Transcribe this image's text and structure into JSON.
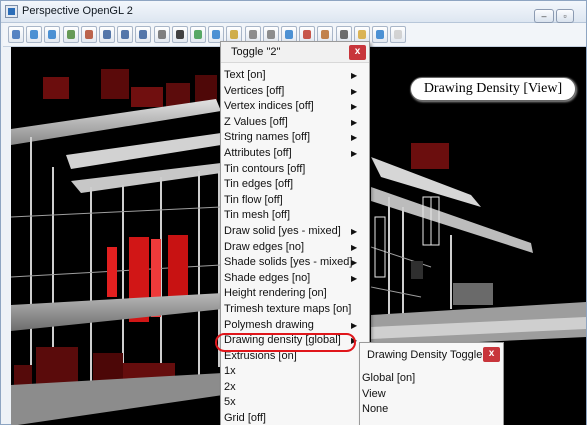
{
  "window": {
    "title": "Perspective OpenGL 2",
    "min_label": "–",
    "max_label": "▫",
    "close_label": "x"
  },
  "toolbar": {
    "buttons": [
      {
        "name": "new-view-icon",
        "color": "#3a6fb8"
      },
      {
        "name": "zoom-in-icon",
        "color": "#2f7fcc"
      },
      {
        "name": "zoom-out-icon",
        "color": "#2f7fcc"
      },
      {
        "name": "pan-icon",
        "color": "#4d8a3a"
      },
      {
        "name": "rotate-icon",
        "color": "#b24a2e"
      },
      {
        "name": "zoom-extents-icon",
        "color": "#375f9b"
      },
      {
        "name": "zoom-window-icon",
        "color": "#375f9b"
      },
      {
        "name": "zoom-previous-icon",
        "color": "#375f9b"
      },
      {
        "name": "walk-icon",
        "color": "#6a6a6a"
      },
      {
        "name": "eye-icon",
        "color": "#222222"
      },
      {
        "name": "render-icon",
        "color": "#3c9a4b"
      },
      {
        "name": "fly-icon",
        "color": "#2f7fcc"
      },
      {
        "name": "lights-icon",
        "color": "#c9a12b"
      },
      {
        "name": "camera-icon",
        "color": "#7a7a7a"
      },
      {
        "name": "settings-icon",
        "color": "#7a7a7a"
      },
      {
        "name": "texture-icon",
        "color": "#2f7fcc"
      },
      {
        "name": "section-icon",
        "color": "#c0392b"
      },
      {
        "name": "clip-icon",
        "color": "#b86d2e"
      },
      {
        "name": "measure-icon",
        "color": "#555555"
      },
      {
        "name": "folder-icon",
        "color": "#d6a83a"
      },
      {
        "name": "star-icon",
        "color": "#2f7fcc"
      },
      {
        "name": "blank-icon",
        "color": "#cccccc"
      }
    ]
  },
  "overlay": {
    "text": "Drawing Density [View]"
  },
  "menu": {
    "title": "Toggle \"2\"",
    "close_label": "x",
    "items": [
      {
        "label": "Text [on]",
        "submenu": true
      },
      {
        "label": "Vertices [off]",
        "submenu": true
      },
      {
        "label": "Vertex indices [off]",
        "submenu": true
      },
      {
        "label": "Z Values [off]",
        "submenu": true
      },
      {
        "label": "String names [off]",
        "submenu": true
      },
      {
        "label": "Attributes [off]",
        "submenu": true
      },
      {
        "label": "Tin contours [off]",
        "submenu": false
      },
      {
        "label": "Tin edges [off]",
        "submenu": false
      },
      {
        "label": "Tin flow [off]",
        "submenu": false
      },
      {
        "label": "Tin mesh [off]",
        "submenu": false
      },
      {
        "label": "Draw solid [yes - mixed]",
        "submenu": true
      },
      {
        "label": "Draw edges [no]",
        "submenu": true
      },
      {
        "label": "Shade solids [yes - mixed]",
        "submenu": true
      },
      {
        "label": "Shade edges [no]",
        "submenu": true
      },
      {
        "label": "Height rendering [on]",
        "submenu": false
      },
      {
        "label": "Trimesh texture maps [on]",
        "submenu": false
      },
      {
        "label": "Polymesh drawing",
        "submenu": true
      },
      {
        "label": "Drawing density [global]",
        "submenu": true
      },
      {
        "label": "Extrusions [on]",
        "submenu": false
      },
      {
        "label": "1x",
        "submenu": false
      },
      {
        "label": "2x",
        "submenu": false
      },
      {
        "label": "5x",
        "submenu": false
      },
      {
        "label": "Grid [off]",
        "submenu": false
      }
    ]
  },
  "submenu": {
    "title": "Drawing Density Toggle",
    "close_label": "x",
    "items": [
      "Global [on]",
      "View",
      "None"
    ]
  }
}
